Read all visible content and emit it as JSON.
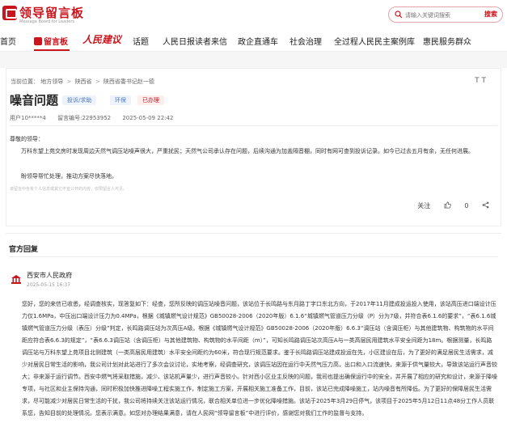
{
  "header": {
    "logo_title": "领导留言板",
    "logo_subtitle": "Message Board for Leaders",
    "search_placeholder": "请输入关键词搜索",
    "search_button": "搜索"
  },
  "nav": {
    "items": [
      {
        "label": "首页"
      },
      {
        "label": "留言板"
      },
      {
        "label": "人民建议"
      },
      {
        "label": "话题"
      },
      {
        "label": "人民日报读者来信"
      },
      {
        "label": "政企直通车"
      },
      {
        "label": "社会治理"
      },
      {
        "label": "全过程人民民主案例库"
      },
      {
        "label": "惠民服务群众"
      }
    ]
  },
  "breadcrumb": {
    "prefix": "当前位置：",
    "items": [
      "地方领导",
      "陕西省",
      "陕西省委书记赵一德"
    ]
  },
  "font_toggle": "T T",
  "message": {
    "title": "噪音问题",
    "tags": {
      "type": "投诉/求助",
      "field": "环保",
      "status": "已办理"
    },
    "user": "用户10*****4",
    "message_id": "留言编号:22953952",
    "date": "2025-05-09 22:42",
    "greeting": "尊敬的领导：",
    "body": "万科东望上苑交房时发现周边天然气调压站噪声很大，严重扰民；天然气公司承认存在问题，后续沟通为加盖隔音棚，同时有网可查到投诉记录。如今已过去五月有余，无任何进展。",
    "closing": "盼领导帮忙处理，推动方案尽快落地。",
    "notice": "该留言中含有个人信息或其它不宜公开的内容，仅限留言人可见。",
    "follow": "关注",
    "like": "0",
    "like_icon": "thumb-up",
    "share_icon": "share"
  },
  "official": {
    "section_title": "官方回复",
    "org": "西安市人民政府",
    "time": "2025-05-15 16:37",
    "reply": "您好，您的来信已收悉，经调查核实，现答复如下：经查，您所反映的调压站噪音问题，该站位于长鸣路与东月路丁字口东北方向，于2017年11月建成投运投入使用，该站高压进口端设计压力仅1.6MPa，中压出口端设计压力为0.4MPa，根据《城镇燃气设计规范》GB50028-2006（2020年版）6.1.6“城镇燃气管道压力分级（P）分为7级，并符合表6.1.6的要求”，“表6.1.6城镇燃气管道压力分级（表压）分级”判定，长鸣路调压站为次高压A级。根据《城镇燃气设计规范》GB50028-2006（2020年版）6.6.3“调压站（含调压柜）与其他建筑物、构筑物的水平间距应符合表6.6.3的规定”，“表6.6.3调压站（含调压柜）与其他建筑物、构筑物的水平间距（m）”，可知长鸣路调压站次高压A与一类高层民用建筑水平安全间距为18m。根据测量，长鸣路调压站与万科东望上苑项目北侧建筑（一类高层民用建筑）水平安全间距约为60米，符合现行规范要求。鉴于长鸣路调压站建成投运在先，小区建设在后，为了更好的满足居民生活需求，减少对居民日常生活的影响，我公司计划对此站进行了多次会议讨论，实地考察，经调查研究，该调压站因在运行中天然气压力高，出口和入口流速快，来源于供气量较大，导致该站运行声音较大；非来源于运行调节。西安中燃气将采取措施，减少、该站机声量少，进行声音较小。针对西小区业主反映的问题，我司也提出确保运行中的安全，并开展了相应的研究和设计，来源于降噪专项，与社区和业主保持沟通，同时积极加快推进降噪工程实施工作，制定施工方案，开展相关施工准备工作，目前，该站已完成降噪施工，站内噪音有所降低。为了更好的保障居民生活需求，尽可能减少对居民日常生活的干扰，我公司将持续关注该站运行情况，联合相关单位进一步优化降噪措施。该站于2025年3月29日停气，该项目于2025年5月12日11点48分工作人员联系您，告知目前的处理情况。您表示满意。如您对办理结果满意，请在人民网“领导留言板”中进行评价，感谢您对我们工作的监督与支持。"
  }
}
